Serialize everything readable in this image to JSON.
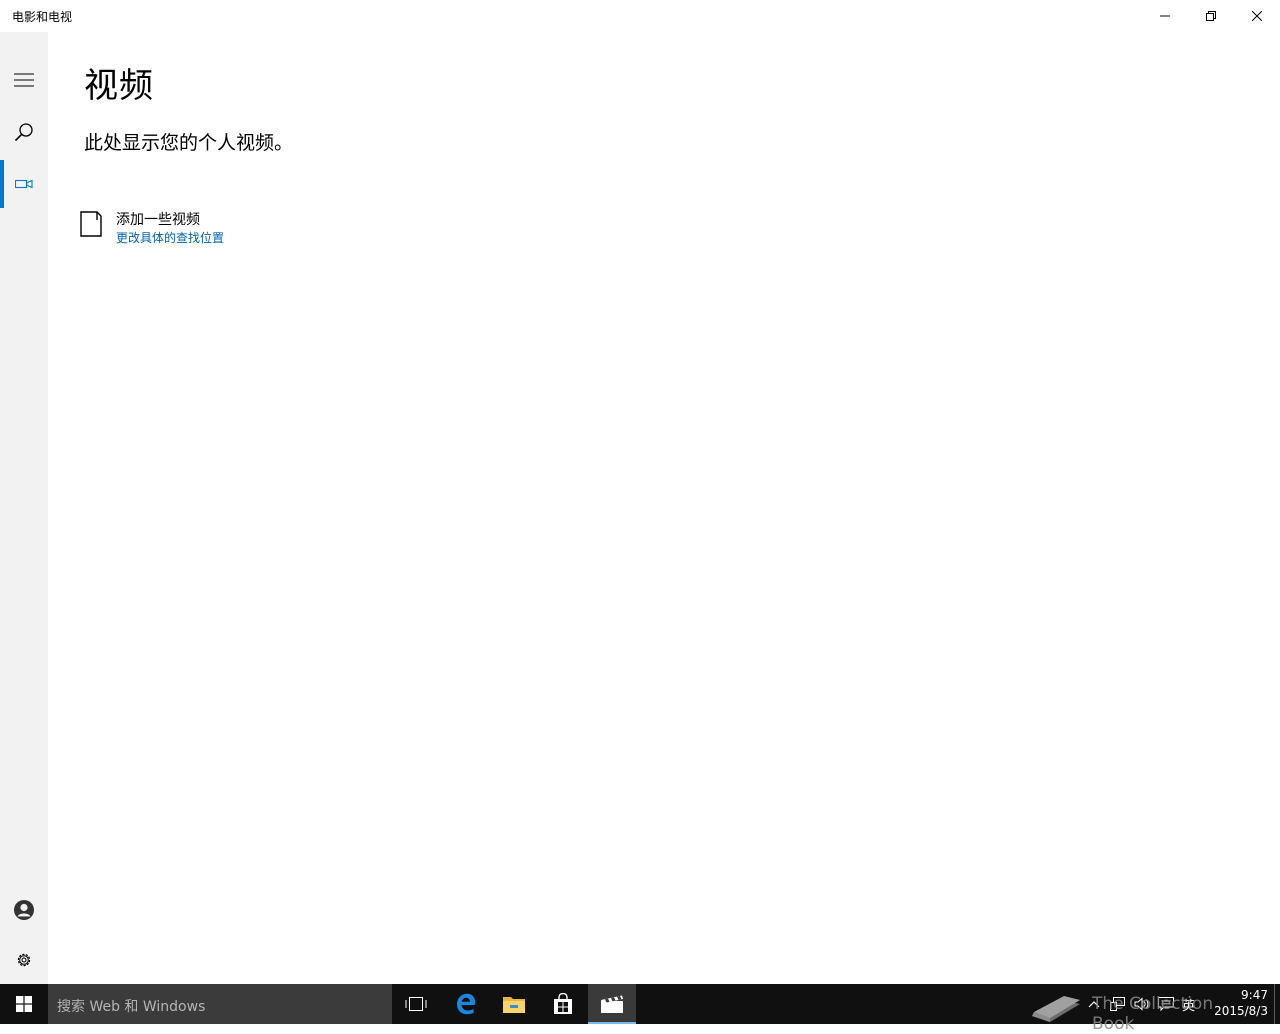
{
  "window": {
    "title": "电影和电视"
  },
  "nav": {
    "items": [
      {
        "name": "hamburger-menu",
        "icon": "hamburger-icon"
      },
      {
        "name": "search",
        "icon": "search-icon"
      },
      {
        "name": "video",
        "icon": "video-camera-icon",
        "selected": true
      },
      {
        "name": "account",
        "icon": "account-icon"
      },
      {
        "name": "settings",
        "icon": "gear-icon"
      }
    ],
    "accent_color": "#0078d7"
  },
  "main": {
    "title": "视频",
    "subtitle": "此处显示您的个人视频。",
    "add_label": "添加一些视频",
    "add_link": "更改具体的查找位置"
  },
  "taskbar": {
    "search_placeholder": "搜索 Web 和 Windows",
    "apps": [
      "task-view-icon",
      "edge-icon",
      "file-explorer-icon",
      "store-icon",
      "movies-tv-icon"
    ],
    "active_app": "movies-tv-icon",
    "watermark": "The Collection Book",
    "ime": "英",
    "time": "9:47",
    "date": "2015/8/3"
  },
  "colors": {
    "link": "#0063b1",
    "taskbar": "#101010",
    "search_box": "#3b3b3b",
    "nav_bg": "#f2f2f2"
  }
}
